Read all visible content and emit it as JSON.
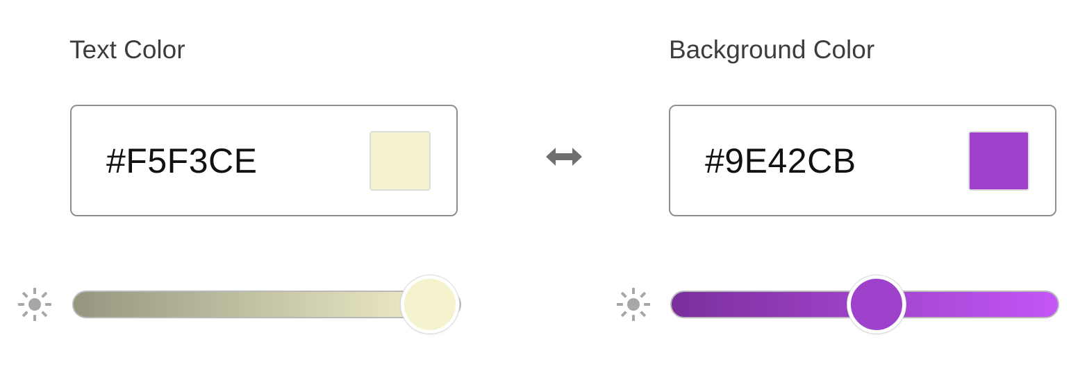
{
  "text_color": {
    "label": "Text Color",
    "hex": "#F5F3CE",
    "swatch_color": "#F5F3CE",
    "slider": {
      "value_fraction": 0.92,
      "gradient_start": "#96967f",
      "gradient_end": "#f5f3ce"
    }
  },
  "background_color": {
    "label": "Background Color",
    "hex": "#9E42CB",
    "swatch_color": "#9E42CB",
    "slider": {
      "value_fraction": 0.53,
      "gradient_start": "#7a2f9c",
      "gradient_end": "#c456f7"
    }
  },
  "swap": {
    "icon": "swap-horizontal-icon",
    "color": "#6f6f6f"
  },
  "brightness_icon": {
    "icon": "brightness-sun-icon",
    "color": "#a7a7a7"
  },
  "colors": {
    "label_text": "#3a3f3a",
    "field_border": "#8e8e8e"
  }
}
